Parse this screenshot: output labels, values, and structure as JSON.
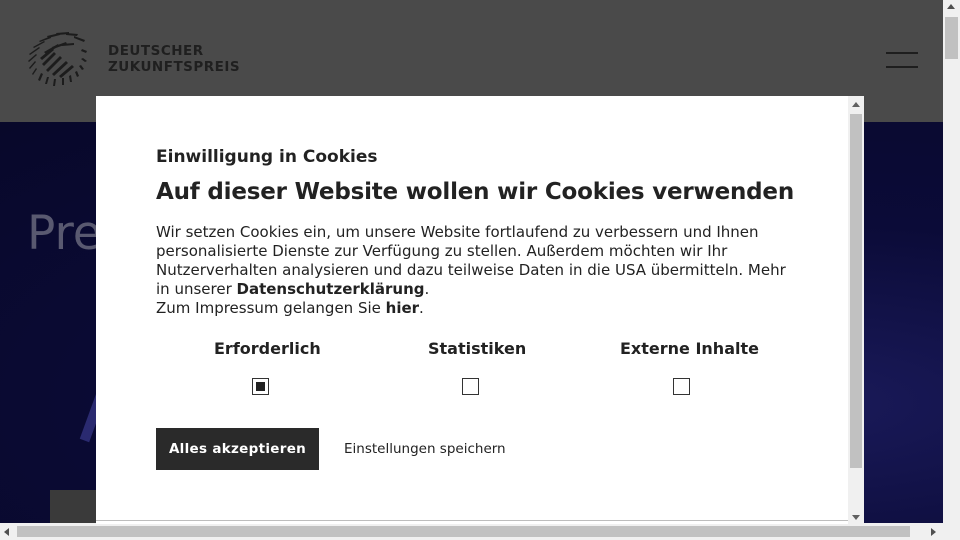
{
  "header": {
    "logo_line1": "DEUTSCHER",
    "logo_line2": "ZUKUNFTSPREIS",
    "menu_icon": "hamburger-menu-icon"
  },
  "hero": {
    "title": "Pre"
  },
  "cookie_modal": {
    "eyebrow": "Einwilligung in Cookies",
    "heading": "Auf dieser Website wollen wir Cookies verwenden",
    "body_part1": "Wir setzen Cookies ein, um unsere Website fortlaufend zu verbessern und Ihnen personalisierte Dienste zur Verfügung zu stellen. Außerdem möchten wir Ihr Nutzerverhalten analysieren und dazu teilweise Daten in die USA übermitteln. Mehr in unserer ",
    "privacy_link": "Datenschutzerklärung",
    "body_part2": ".",
    "imprint_text": "Zum Impressum gelangen Sie ",
    "imprint_link": "hier",
    "imprint_end": ".",
    "categories": [
      {
        "label": "Erforderlich",
        "checked": true
      },
      {
        "label": "Statistiken",
        "checked": false
      },
      {
        "label": "Externe Inhalte",
        "checked": false
      }
    ],
    "accept_all_label": "Alles akzeptieren",
    "save_settings_label": "Einstellungen speichern"
  },
  "colors": {
    "header_bg": "#4a4a4a",
    "hero_bg": "#0b0b38",
    "button_dark": "#2a2a2a"
  }
}
